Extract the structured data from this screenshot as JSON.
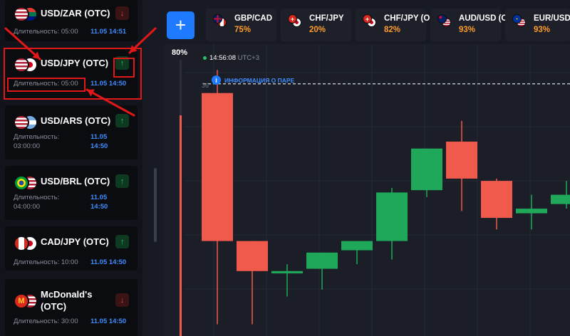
{
  "assets": [
    {
      "name": "USD/ZAR (OTC)",
      "name2": "",
      "duration_label": "Длительность: 05:00",
      "duration_label2": "",
      "time": "11.05 14:51",
      "time2": "",
      "direction": "down",
      "direction_icon": "↓",
      "flags": [
        "us",
        "za"
      ]
    },
    {
      "name": "USD/JPY (OTC)",
      "name2": "",
      "duration_label": "Длительность: 05:00",
      "duration_label2": "",
      "time": "11.05 14:50",
      "time2": "",
      "direction": "up",
      "direction_icon": "↑",
      "flags": [
        "us",
        "jp"
      ]
    },
    {
      "name": "USD/ARS (OTC)",
      "name2": "",
      "duration_label": "Длительность:",
      "duration_label2": "03:00:00",
      "time": "11.05",
      "time2": "14:50",
      "direction": "up",
      "direction_icon": "↑",
      "flags": [
        "us",
        "ar"
      ]
    },
    {
      "name": "USD/BRL (OTC)",
      "name2": "",
      "duration_label": "Длительность:",
      "duration_label2": "04:00:00",
      "time": "11.05",
      "time2": "14:50",
      "direction": "up",
      "direction_icon": "↑",
      "flags": [
        "br",
        "us"
      ]
    },
    {
      "name": "CAD/JPY (OTC)",
      "name2": "",
      "duration_label": "Длительность: 10:00",
      "duration_label2": "",
      "time": "11.05 14:50",
      "time2": "",
      "direction": "up",
      "direction_icon": "↑",
      "flags": [
        "ca",
        "jp"
      ]
    },
    {
      "name": "McDonald's",
      "name2": "(OTC)",
      "duration_label": "Длительность: 30:00",
      "duration_label2": "",
      "time": "11.05 14:50",
      "time2": "",
      "direction": "down",
      "direction_icon": "↓",
      "flags": [
        "mcd",
        "us"
      ]
    }
  ],
  "add_button_label": "+",
  "tabs": [
    {
      "name": "GBP/CAD",
      "percent": "75%",
      "flags": [
        "gb",
        "ca"
      ]
    },
    {
      "name": "CHF/JPY",
      "percent": "20%",
      "flags": [
        "ch",
        "jp"
      ]
    },
    {
      "name": "CHF/JPY (O",
      "percent": "82%",
      "flags": [
        "ch",
        "jp"
      ]
    },
    {
      "name": "AUD/USD (O",
      "percent": "93%",
      "flags": [
        "au",
        "us"
      ]
    },
    {
      "name": "EUR/USD",
      "percent": "93%",
      "flags": [
        "eu",
        "us"
      ]
    }
  ],
  "chart": {
    "payout_percent_label": "80%",
    "payout_percent": 80,
    "clock_time": "14:56:08",
    "clock_tz": "UTC+3",
    "info_label": "ИНФОРМАЦИЯ О ПАРЕ",
    "left_value": "36"
  },
  "colors": {
    "accent": "#1e7bff",
    "up": "#1fa85a",
    "down": "#ef5a4c",
    "percent": "#ff9c2a"
  },
  "chart_data": {
    "type": "candlestick",
    "title": "",
    "candles": [
      {
        "open": 0.9,
        "high": 1.0,
        "low": -0.1,
        "close": 0.26,
        "dir": "down"
      },
      {
        "open": 0.26,
        "high": 0.26,
        "low": -0.1,
        "close": 0.13,
        "dir": "down"
      },
      {
        "open": 0.12,
        "high": 0.16,
        "low": 0.02,
        "close": 0.13,
        "dir": "up"
      },
      {
        "open": 0.14,
        "high": 0.16,
        "low": 0.05,
        "close": 0.21,
        "dir": "up"
      },
      {
        "open": 0.22,
        "high": 0.23,
        "low": 0.16,
        "close": 0.26,
        "dir": "up"
      },
      {
        "open": 0.26,
        "high": 0.49,
        "low": 0.18,
        "close": 0.47,
        "dir": "up"
      },
      {
        "open": 0.48,
        "high": 0.63,
        "low": 0.45,
        "close": 0.66,
        "dir": "up"
      },
      {
        "open": 0.69,
        "high": 0.78,
        "low": 0.39,
        "close": 0.53,
        "dir": "down"
      },
      {
        "open": 0.52,
        "high": 0.53,
        "low": 0.31,
        "close": 0.36,
        "dir": "down"
      },
      {
        "open": 0.38,
        "high": 0.46,
        "low": 0.31,
        "close": 0.4,
        "dir": "up"
      },
      {
        "open": 0.42,
        "high": 0.52,
        "low": 0.4,
        "close": 0.46,
        "dir": "up"
      }
    ],
    "ylim": [
      -0.12,
      1.05
    ],
    "grid": true,
    "dashed_level": 0.94
  }
}
